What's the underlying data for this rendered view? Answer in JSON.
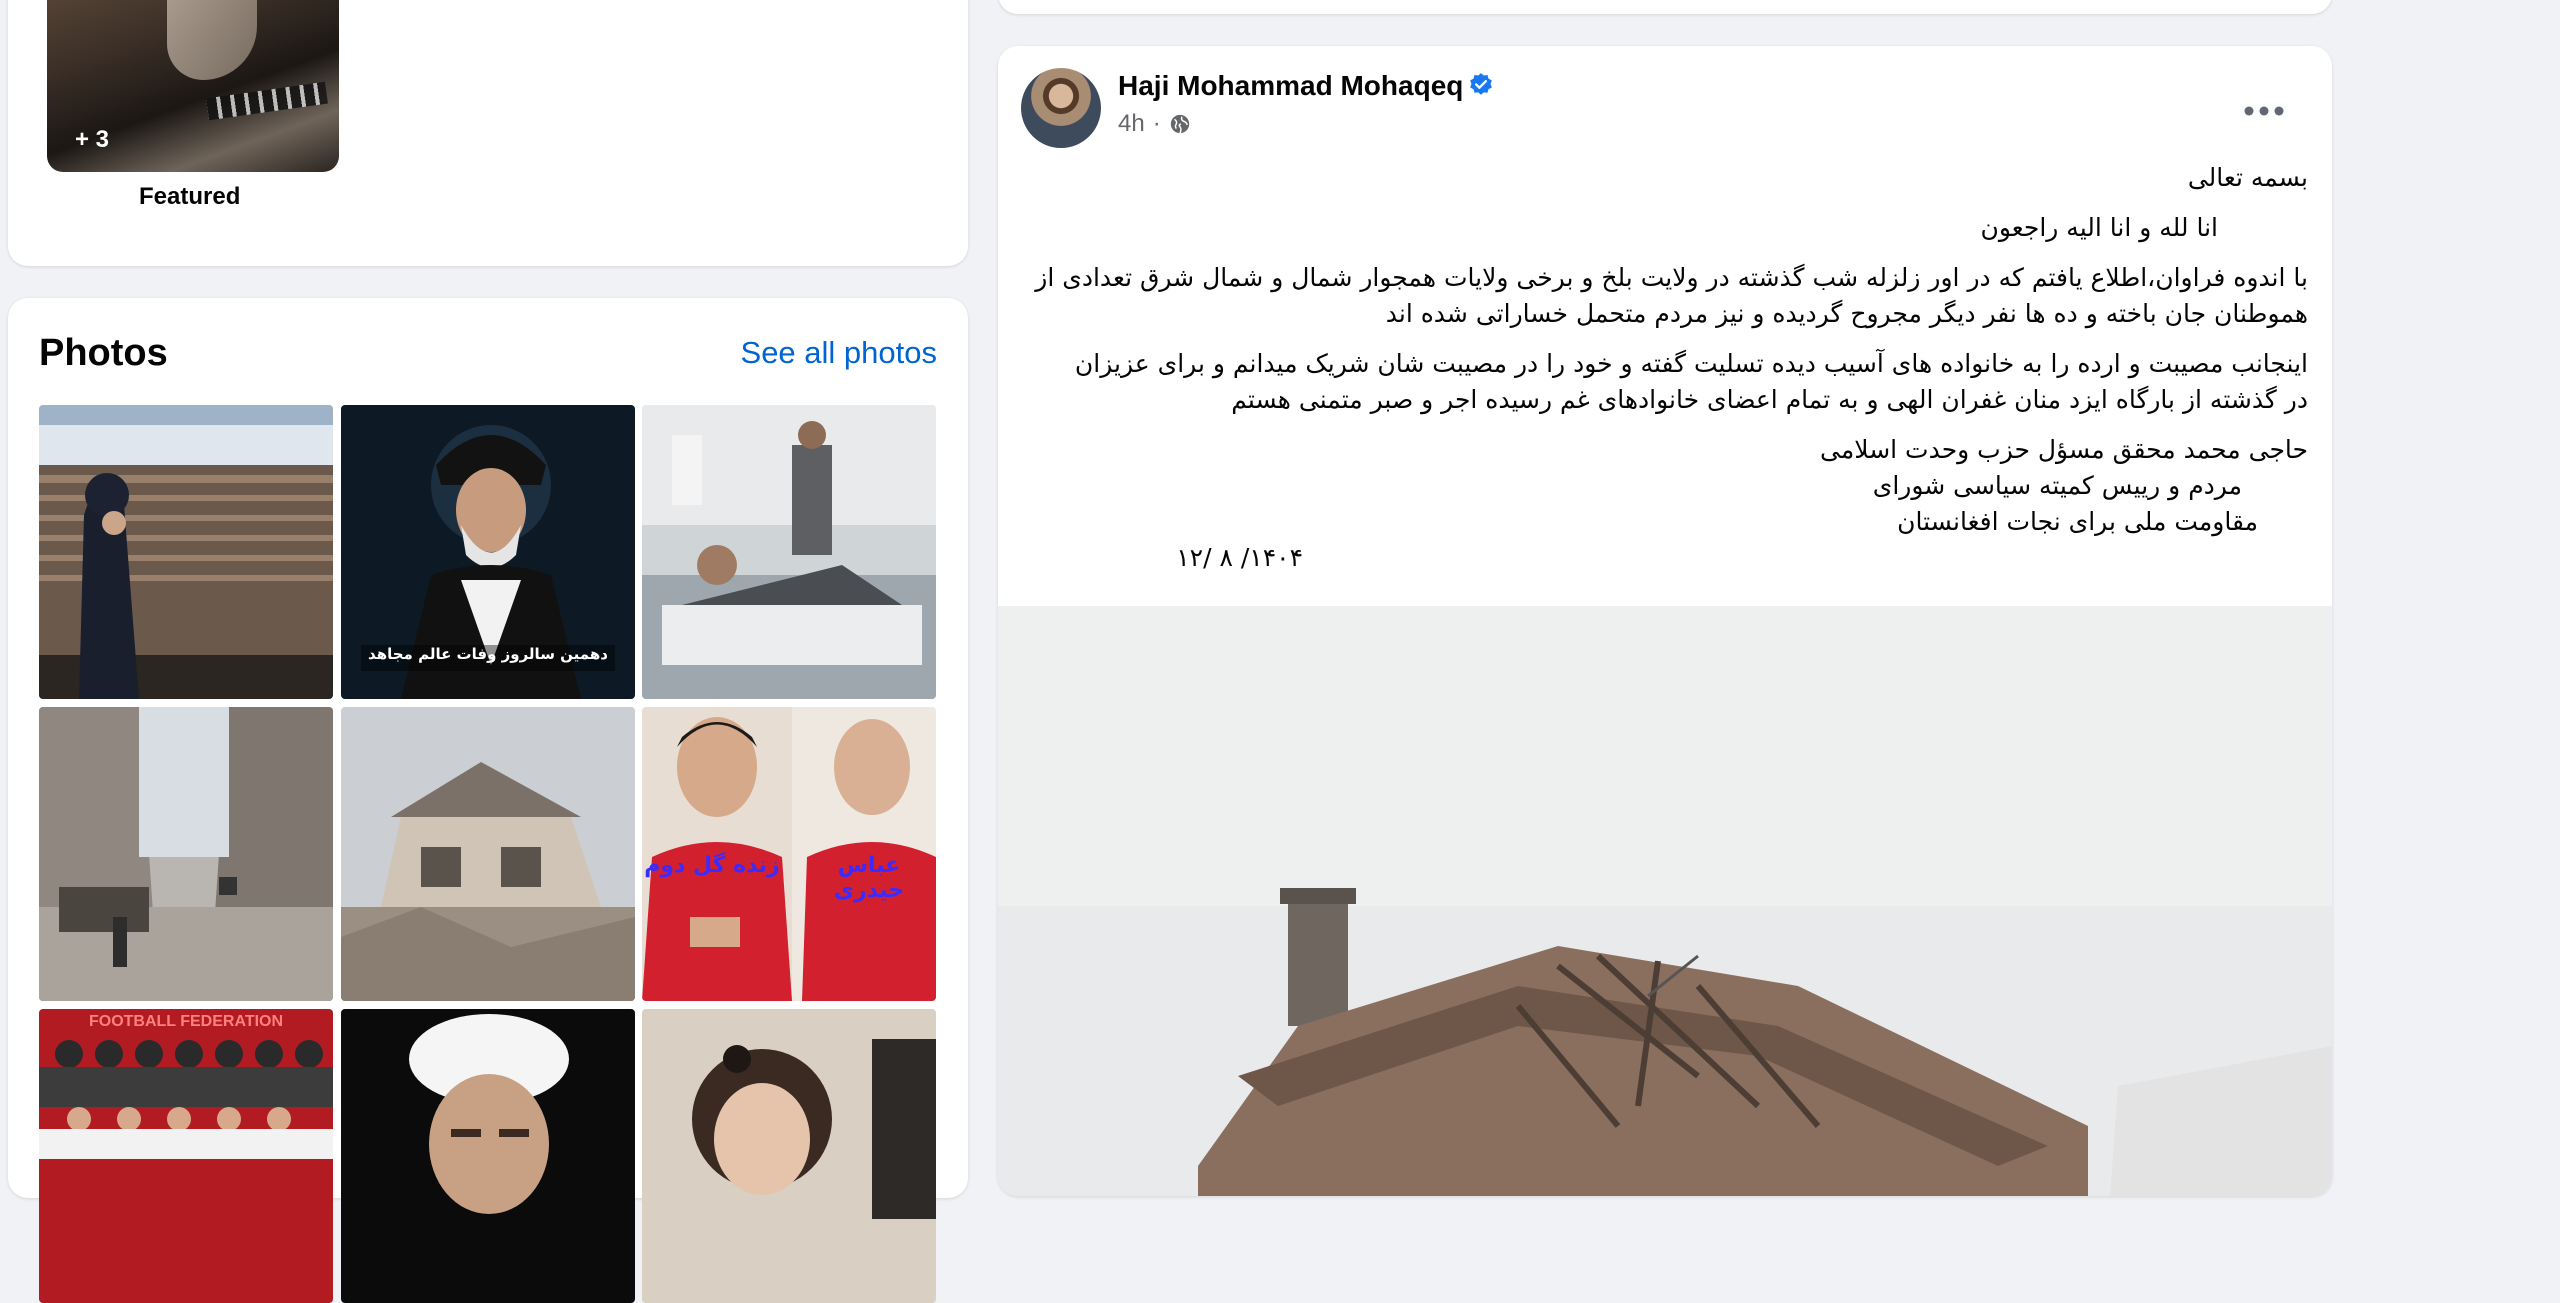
{
  "featured": {
    "count_label": "+ 3",
    "label": "Featured"
  },
  "photos": {
    "title": "Photos",
    "see_all": "See all photos",
    "items": [
      {
        "caption": ""
      },
      {
        "caption": "دهمین سالروز وفات عالم مجاهد"
      },
      {
        "caption": ""
      },
      {
        "caption": ""
      },
      {
        "caption": ""
      },
      {
        "caption": "زنده گل دوم",
        "caption2": "عباس حیدری"
      },
      {
        "caption": "FOOTBALL FEDERATION"
      },
      {
        "caption": ""
      },
      {
        "caption": ""
      }
    ]
  },
  "post": {
    "author": "Haji Mohammad Mohaqeq",
    "time": "4h",
    "dot": "·",
    "body": {
      "p1": "بسمه تعالی",
      "p2": "انا لله و انا الیه راجعون",
      "p3_l1": "با اندوه فراوان،اطلاع یافتم که در اور زلزله شب گذشته در ولایت بلخ و برخی ولایات همجوار شمال و شمال شرق تعدادی از",
      "p3_l2": "هموطنان جان باخته و ده ها نفر دیگر مجروح گردیده و نیز مردم متحمل خساراتی شده اند",
      "p4_l1": "اینجانب مصیبت و ارده  را به خانواده های آسیب دیده تسلیت گفته و خود را در مصیبت شان شریک میدانم  و برای عزیزان",
      "p4_l2": "در گذشته از بارگاه ایزد منان غفران الهی و به تمام اعضای خانوادهای غم رسیده اجر و صبر متمنی هستم",
      "sig1": "حاجی محمد محقق مسؤل حزب وحدت اسلامی",
      "sig2": "مردم و رییس کمیته سیاسی شورای",
      "sig3": "مقاومت ملی برای نجات افغانستان",
      "date": "۱۴۰۴/ ۸ /۱۲"
    }
  },
  "colors": {
    "accent": "#0064d1",
    "verified": "#1877f2",
    "background": "#f0f2f5"
  },
  "icons": {
    "verified": "verified-badge-icon",
    "privacy": "globe-icon",
    "more": "more-options-icon"
  }
}
